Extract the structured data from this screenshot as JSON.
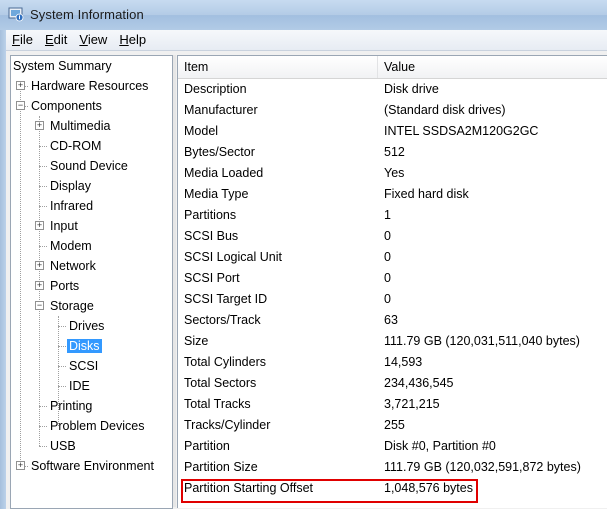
{
  "window": {
    "title": "System Information"
  },
  "menu": [
    {
      "label_acc": "F",
      "label_rest": "ile"
    },
    {
      "label_acc": "E",
      "label_rest": "dit"
    },
    {
      "label_acc": "V",
      "label_rest": "iew"
    },
    {
      "label_acc": "H",
      "label_rest": "elp"
    }
  ],
  "tree": {
    "items": [
      "System Summary",
      "Hardware Resources",
      "Components",
      "Multimedia",
      "CD-ROM",
      "Sound Device",
      "Display",
      "Infrared",
      "Input",
      "Modem",
      "Network",
      "Ports",
      "Storage",
      "Drives",
      "Disks",
      "SCSI",
      "IDE",
      "Printing",
      "Problem Devices",
      "USB",
      "Software Environment"
    ],
    "selected": "Disks"
  },
  "list": {
    "columns": {
      "item": "Item",
      "value": "Value"
    },
    "rows": [
      {
        "item": "Description",
        "value": "Disk drive"
      },
      {
        "item": "Manufacturer",
        "value": "(Standard disk drives)"
      },
      {
        "item": "Model",
        "value": "INTEL SSDSA2M120G2GC"
      },
      {
        "item": "Bytes/Sector",
        "value": "512"
      },
      {
        "item": "Media Loaded",
        "value": "Yes"
      },
      {
        "item": "Media Type",
        "value": "Fixed hard disk"
      },
      {
        "item": "Partitions",
        "value": "1"
      },
      {
        "item": "SCSI Bus",
        "value": "0"
      },
      {
        "item": "SCSI Logical Unit",
        "value": "0"
      },
      {
        "item": "SCSI Port",
        "value": "0"
      },
      {
        "item": "SCSI Target ID",
        "value": "0"
      },
      {
        "item": "Sectors/Track",
        "value": "63"
      },
      {
        "item": "Size",
        "value": "111.79 GB (120,031,511,040 bytes)"
      },
      {
        "item": "Total Cylinders",
        "value": "14,593"
      },
      {
        "item": "Total Sectors",
        "value": "234,436,545"
      },
      {
        "item": "Total Tracks",
        "value": "3,721,215"
      },
      {
        "item": "Tracks/Cylinder",
        "value": "255"
      },
      {
        "item": "Partition",
        "value": "Disk #0, Partition #0"
      },
      {
        "item": "Partition Size",
        "value": "111.79 GB (120,032,591,872 bytes)"
      },
      {
        "item": "Partition Starting Offset",
        "value": "1,048,576 bytes"
      }
    ]
  },
  "colors": {
    "highlight_box": "#e00000",
    "selection": "#3399ff"
  }
}
